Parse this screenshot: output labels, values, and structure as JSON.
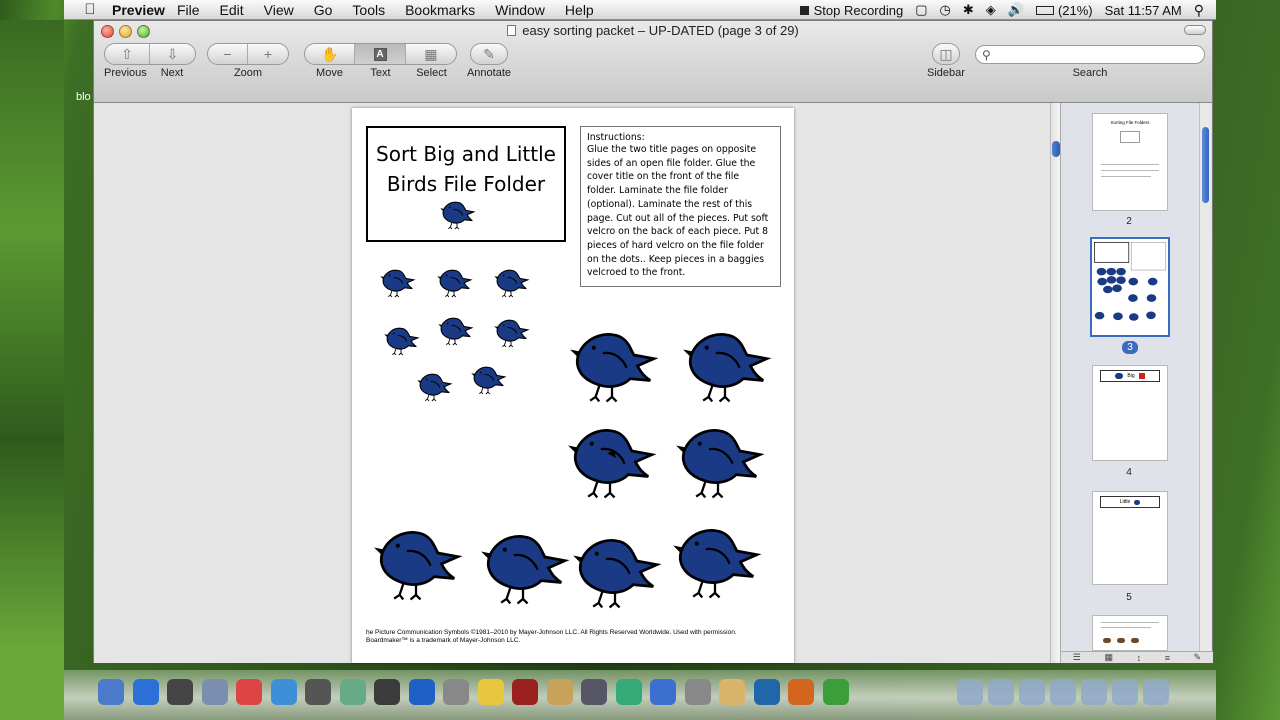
{
  "menubar": {
    "app_name": "Preview",
    "menus": [
      "File",
      "Edit",
      "View",
      "Go",
      "Tools",
      "Bookmarks",
      "Window",
      "Help"
    ],
    "stop_recording": "Stop Recording",
    "battery": "(21%)",
    "clock": "Sat 11:57 AM"
  },
  "desktop": {
    "partial_label": "blo"
  },
  "window": {
    "title": "easy sorting packet – UP-DATED (page 3 of 29)",
    "toolbar": {
      "previous": "Previous",
      "next": "Next",
      "zoom": "Zoom",
      "move": "Move",
      "text": "Text",
      "select": "Select",
      "annotate": "Annotate",
      "sidebar": "Sidebar",
      "search": "Search"
    },
    "search_placeholder": ""
  },
  "document": {
    "title": "Sort Big and Little Birds File Folder",
    "instructions_heading": "Instructions:",
    "instructions_lines": [
      "Glue the two title pages on opposite",
      "sides of an open file folder. Glue the",
      "cover title on the front of the file",
      "folder. Laminate the file folder",
      "(optional). Laminate the rest of this",
      "page. Cut out all of the pieces. Put soft",
      "velcro on the back of each piece. Put 8",
      "pieces of hard velcro on the file folder",
      "on the dots.. Keep pieces in a baggies",
      "velcroed to the front."
    ],
    "credit_line1": "he Picture Communication Symbols ©1981–2010 by Mayer-Johnson LLC. All Rights Reserved Worldwide. Used with permission.",
    "credit_line2": "Boardmaker™ is a trademark of Mayer-Johnson LLC.",
    "bird_color": "#1a3a85"
  },
  "sidebar": {
    "thumbnails": [
      {
        "page": "2",
        "title": "Sorting File Folders"
      },
      {
        "page": "3",
        "selected": true
      },
      {
        "page": "4",
        "label": "Big"
      },
      {
        "page": "5",
        "label": "Little"
      },
      {
        "page": ""
      }
    ]
  },
  "dock": {
    "icons": [
      "finder-icon",
      "app-store-icon",
      "dashboard-icon",
      "mail-icon",
      "calendar-icon",
      "safari-icon",
      "photo-booth-icon",
      "preview-icon",
      "iphoto-icon",
      "itunes-icon",
      "calculator-icon",
      "stickies-icon",
      "photo-icon",
      "iphoto-icon-2",
      "system-icon",
      "grapher-icon",
      "present-icon",
      "tools-icon",
      "kid-icon",
      "smart-icon",
      "firefox-icon",
      "chrome-icon"
    ]
  },
  "colors": {
    "selection_blue": "#3a6cc0",
    "bird_navy": "#1a3a85"
  }
}
